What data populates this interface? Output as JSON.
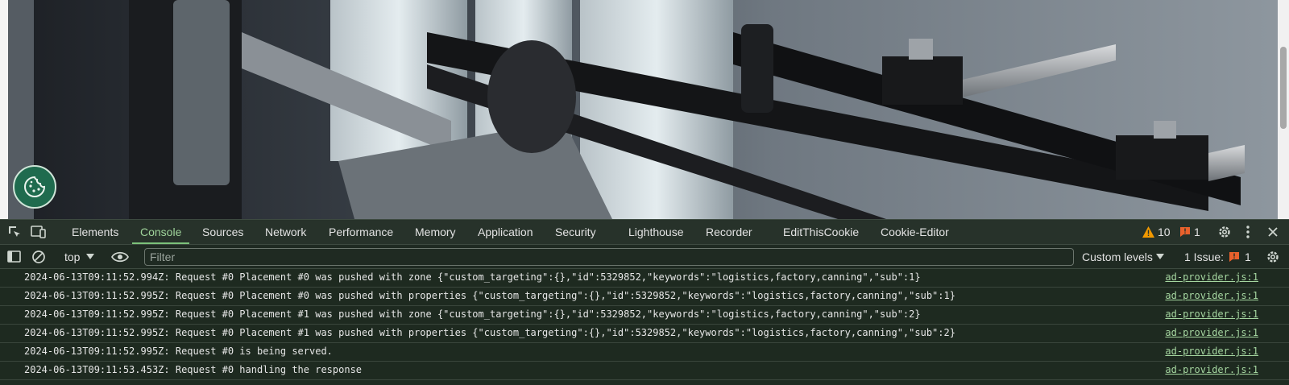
{
  "devtools": {
    "tabs": [
      "Elements",
      "Console",
      "Sources",
      "Network",
      "Performance",
      "Memory",
      "Application",
      "Security",
      "Lighthouse",
      "Recorder",
      "EditThisCookie",
      "Cookie-Editor"
    ],
    "active_tab": "Console",
    "warnings_count": "10",
    "issues_count": "1"
  },
  "toolbar": {
    "context": "top",
    "filter_placeholder": "Filter",
    "levels": "Custom levels",
    "issues_label": "1 Issue:",
    "issues_count": "1"
  },
  "messages": [
    {
      "text": "2024-06-13T09:11:52.994Z: Request #0 Placement #0 was pushed with zone {\"custom_targeting\":{},\"id\":5329852,\"keywords\":\"logistics,factory,canning\",\"sub\":1}",
      "source": "ad-provider.js:1"
    },
    {
      "text": "2024-06-13T09:11:52.995Z: Request #0 Placement #0 was pushed with properties {\"custom_targeting\":{},\"id\":5329852,\"keywords\":\"logistics,factory,canning\",\"sub\":1}",
      "source": "ad-provider.js:1"
    },
    {
      "text": "2024-06-13T09:11:52.995Z: Request #0 Placement #1 was pushed with zone {\"custom_targeting\":{},\"id\":5329852,\"keywords\":\"logistics,factory,canning\",\"sub\":2}",
      "source": "ad-provider.js:1"
    },
    {
      "text": "2024-06-13T09:11:52.995Z: Request #0 Placement #1 was pushed with properties {\"custom_targeting\":{},\"id\":5329852,\"keywords\":\"logistics,factory,canning\",\"sub\":2}",
      "source": "ad-provider.js:1"
    },
    {
      "text": "2024-06-13T09:11:52.995Z: Request #0 is being served.",
      "source": "ad-provider.js:1"
    },
    {
      "text": "2024-06-13T09:11:53.453Z: Request #0 handling the response",
      "source": "ad-provider.js:1"
    }
  ],
  "colors": {
    "accent": "#7cc27a",
    "warning": "#f29900",
    "issue": "#e8612c",
    "background": "#1e2a20"
  }
}
